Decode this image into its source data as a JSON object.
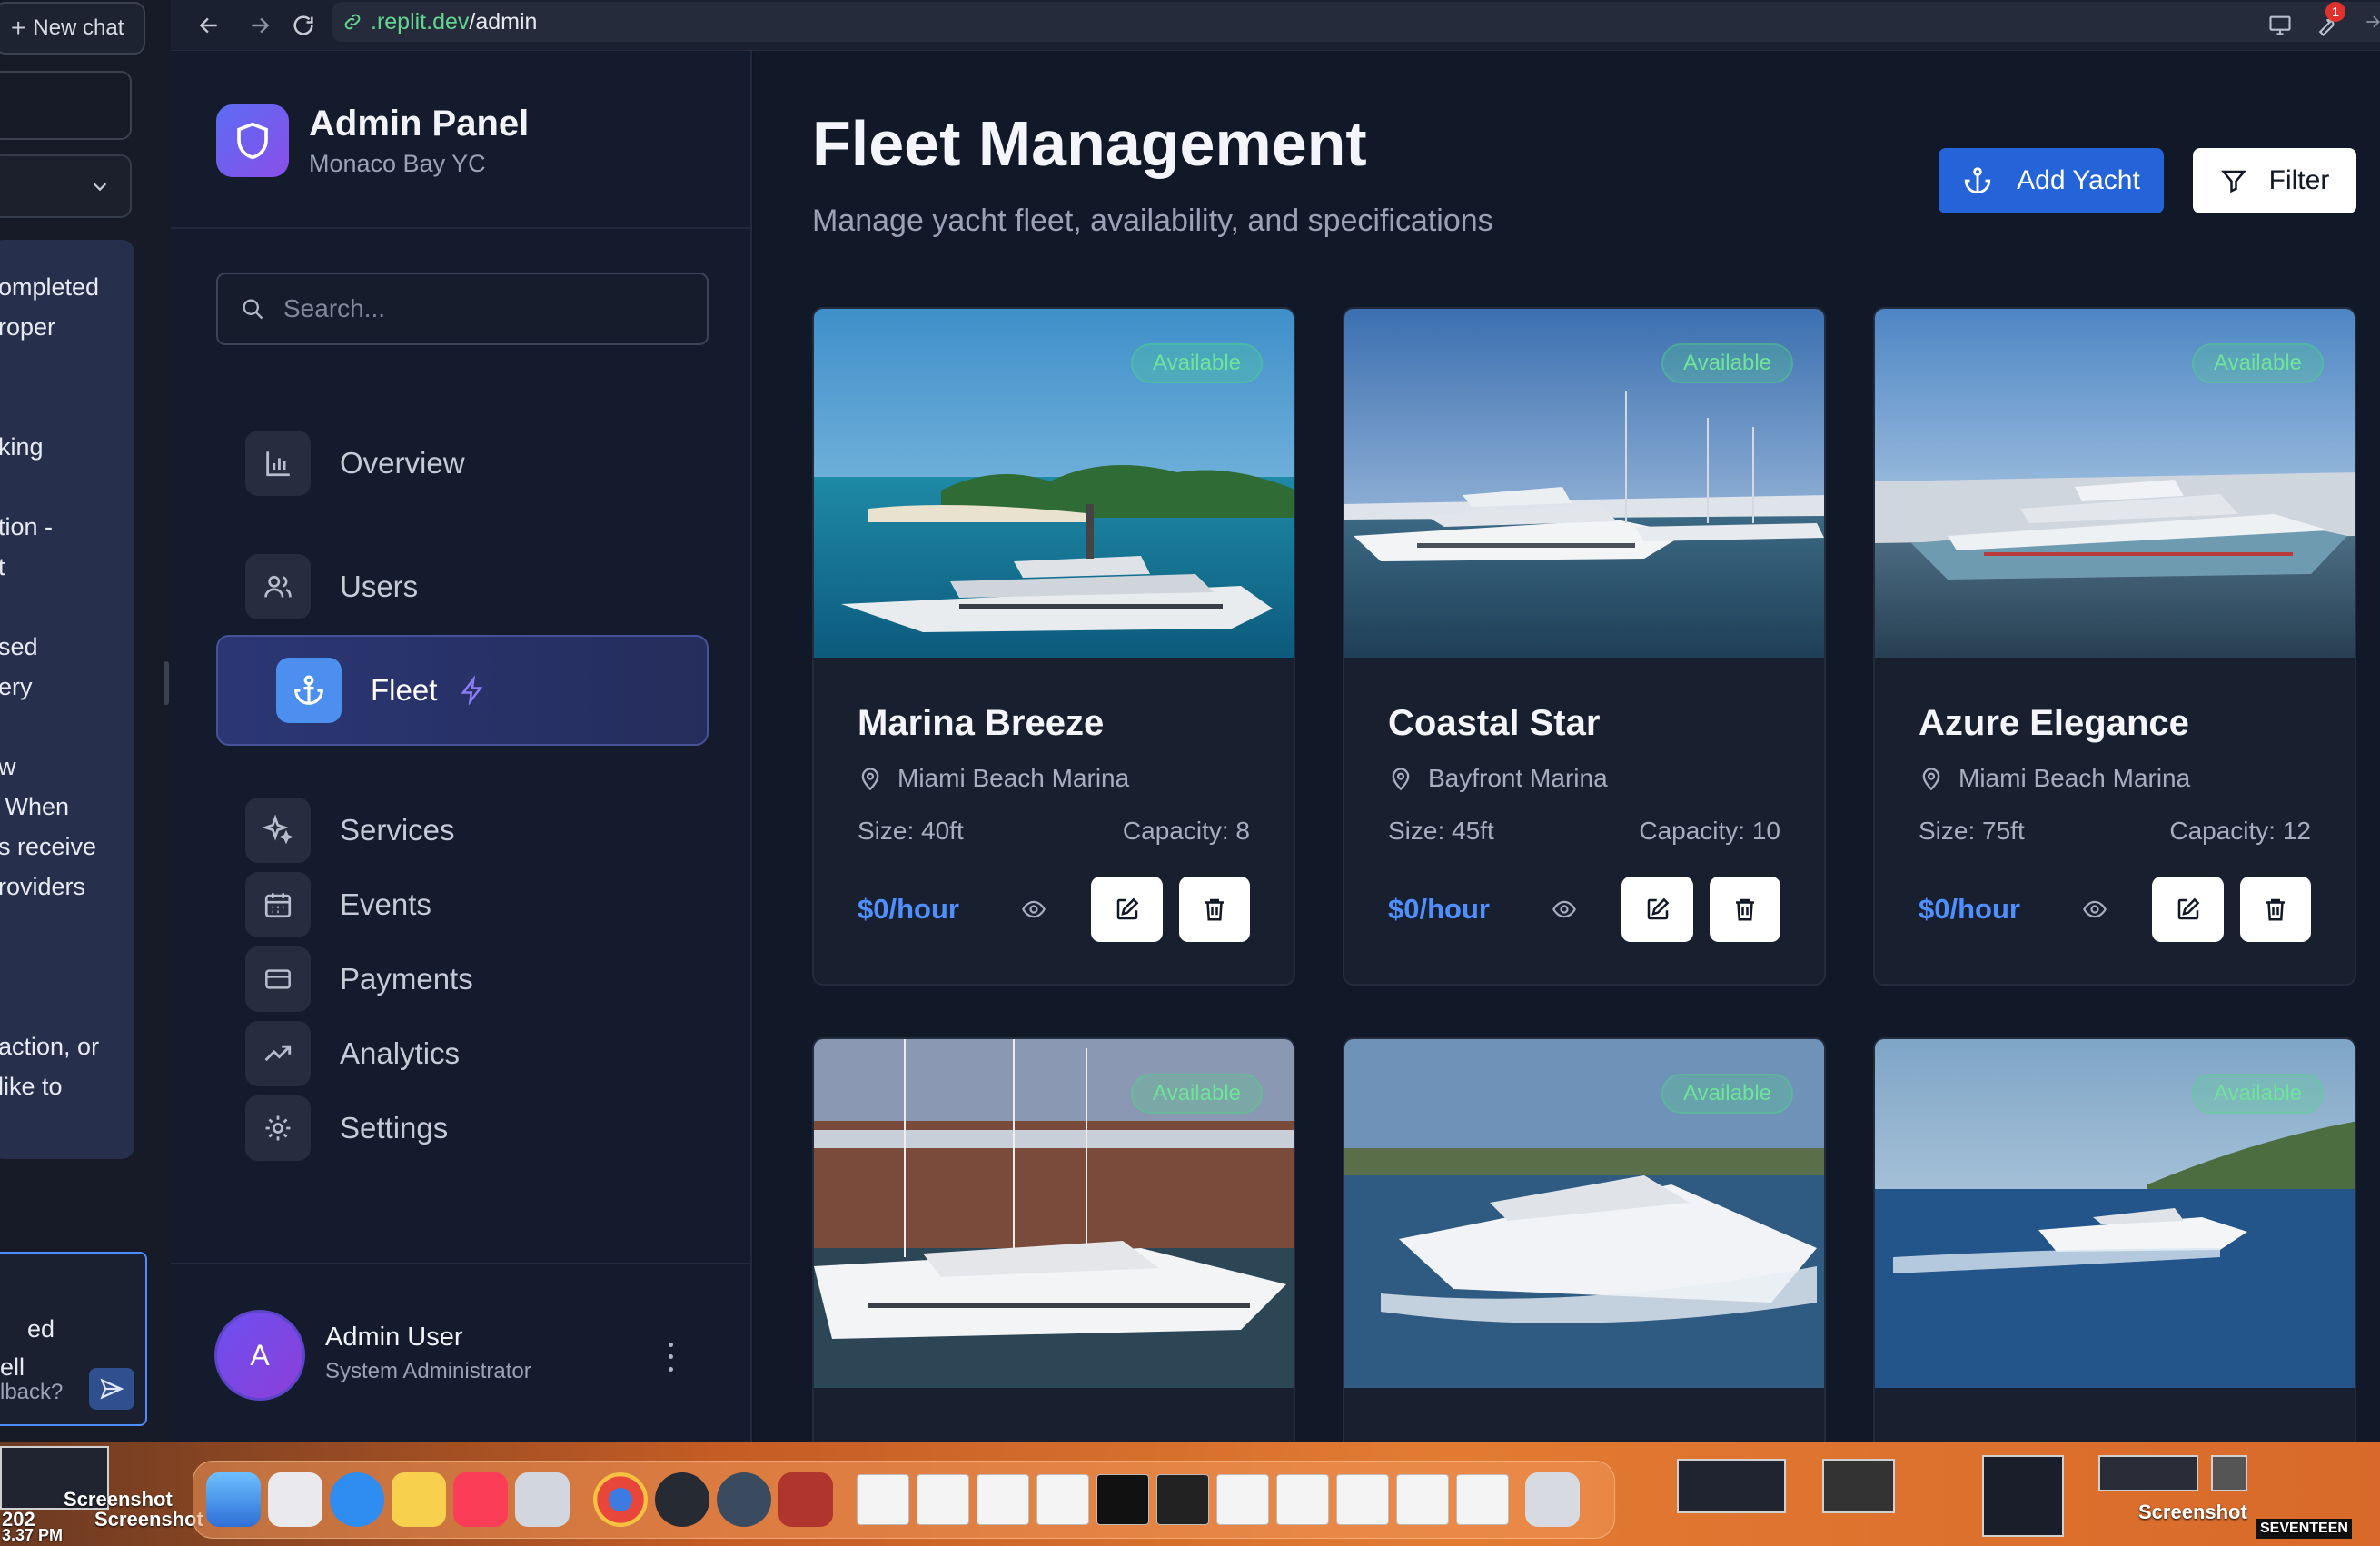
{
  "chat": {
    "new_chat_label": "New chat",
    "panel_text": "ompleted\nroper\n\n\nking\n\ntion -\nt\n\nsed\nery\n\nw\n When\ns receive\nroviders\n\n\n\naction, or\nlike to",
    "input_text": "ed\nell",
    "input_placeholder": "lback?"
  },
  "browser": {
    "url_host": ".replit.dev",
    "url_path": "/admin",
    "notification_count": "1"
  },
  "sidebar": {
    "brand_title": "Admin Panel",
    "brand_subtitle": "Monaco Bay YC",
    "search_placeholder": "Search...",
    "items": [
      {
        "label": "Overview",
        "icon": "bar-chart-icon"
      },
      {
        "label": "Users",
        "icon": "users-icon"
      },
      {
        "label": "Fleet",
        "icon": "anchor-icon",
        "active": true
      },
      {
        "label": "Services",
        "icon": "sparkles-icon"
      },
      {
        "label": "Events",
        "icon": "calendar-icon"
      },
      {
        "label": "Payments",
        "icon": "credit-card-icon"
      },
      {
        "label": "Analytics",
        "icon": "trending-up-icon"
      },
      {
        "label": "Settings",
        "icon": "gear-icon"
      }
    ],
    "user": {
      "initial": "A",
      "name": "Admin User",
      "role": "System Administrator"
    }
  },
  "main": {
    "title": "Fleet Management",
    "subtitle": "Manage yacht fleet, availability, and specifications",
    "add_button": "Add Yacht",
    "filter_button": "Filter",
    "cards": [
      {
        "name": "Marina Breeze",
        "location": "Miami Beach Marina",
        "size": "Size: 40ft",
        "capacity": "Capacity: 8",
        "price": "$0/hour",
        "status": "Available"
      },
      {
        "name": "Coastal Star",
        "location": "Bayfront Marina",
        "size": "Size: 45ft",
        "capacity": "Capacity: 10",
        "price": "$0/hour",
        "status": "Available"
      },
      {
        "name": "Azure Elegance",
        "location": "Miami Beach Marina",
        "size": "Size: 75ft",
        "capacity": "Capacity: 12",
        "price": "$0/hour",
        "status": "Available"
      },
      {
        "status": "Available"
      },
      {
        "status": "Available"
      },
      {
        "status": "Available"
      }
    ]
  },
  "desktop": {
    "labels": [
      "Screenshot",
      "Screenshot",
      "Screenshot",
      "SEVENTEEN",
      "202",
      "3.37 PM"
    ]
  },
  "colors": {
    "accent": "#2563d9",
    "active_nav": "#2b3775",
    "available": "#6fe39a",
    "price": "#4f8fff"
  }
}
